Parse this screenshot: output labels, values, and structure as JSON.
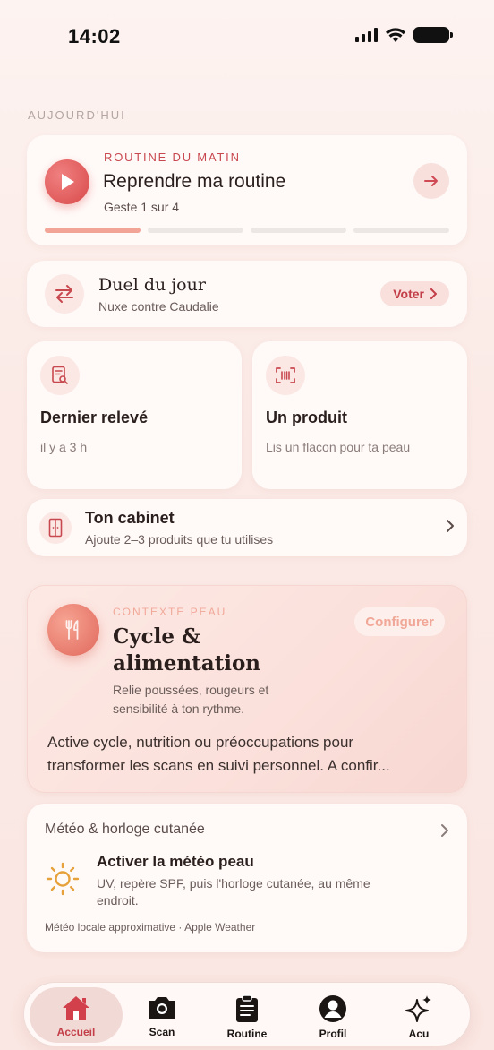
{
  "status_bar": {
    "time": "14:02"
  },
  "section_label": "AUJOURD'HUI",
  "routine": {
    "eyebrow": "ROUTINE DU MATIN",
    "title": "Reprendre ma routine",
    "subtitle": "Geste 1 sur 4",
    "progress": {
      "completed": 1,
      "total": 4
    }
  },
  "duel": {
    "title": "Duel du jour",
    "subtitle": "Nuxe contre Caudalie",
    "button": "Voter"
  },
  "last_reading": {
    "title": "Dernier relevé",
    "subtitle": "il y a 3 h"
  },
  "product": {
    "title": "Un produit",
    "subtitle": "Lis un flacon pour ta peau"
  },
  "cabinet": {
    "title": "Ton cabinet",
    "subtitle": "Ajoute 2–3 produits que tu utilises"
  },
  "context": {
    "eyebrow": "CONTEXTE PEAU",
    "title": "Cycle & alimentation",
    "subtitle": "Relie poussées, rougeurs et sensibilité à ton rythme.",
    "button": "Configurer",
    "body": "Active cycle, nutrition ou préoccupations pour\ntransformer les scans en suivi personnel. A confir..."
  },
  "weather": {
    "header": "Météo & horloge cutanée",
    "title": "Activer la météo peau",
    "subtitle": "UV, repère SPF, puis l'horloge cutanée, au même endroit.",
    "footer": "Météo locale approximative · Apple Weather"
  },
  "tabbar": {
    "items": [
      {
        "label": "Accueil",
        "icon": "home-icon",
        "active": true
      },
      {
        "label": "Scan",
        "icon": "camera-icon",
        "active": false
      },
      {
        "label": "Routine",
        "icon": "clipboard-icon",
        "active": false
      },
      {
        "label": "Profil",
        "icon": "profile-icon",
        "active": false
      },
      {
        "label": "Acu",
        "icon": "sparkle-icon",
        "active": false
      }
    ]
  },
  "colors": {
    "accent": "#c33e48",
    "accent_light": "#f2a596",
    "background": "#fbeae6",
    "card": "#fffaf8"
  }
}
